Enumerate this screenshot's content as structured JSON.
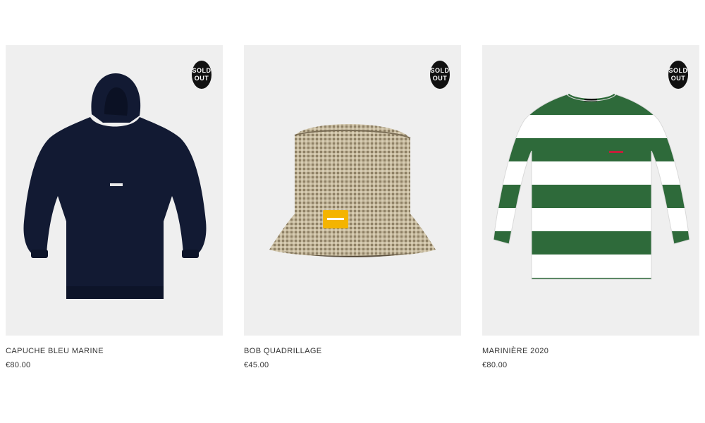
{
  "products": [
    {
      "title": "CAPUCHE BLEU MARINE",
      "price": "€80.00",
      "badge_line1": "SOLD",
      "badge_line2": "OUT",
      "image_icon": "hoodie-icon",
      "colors": {
        "garment": "#121a33"
      }
    },
    {
      "title": "BOB QUADRILLAGE",
      "price": "€45.00",
      "badge_line1": "SOLD",
      "badge_line2": "OUT",
      "image_icon": "bucket-hat-icon",
      "colors": {
        "garment": "#b9ad93",
        "tag": "#f4b400"
      }
    },
    {
      "title": "MARINIÈRE 2020",
      "price": "€80.00",
      "badge_line1": "SOLD",
      "badge_line2": "OUT",
      "image_icon": "striped-shirt-icon",
      "colors": {
        "stripe_green": "#2e6a3a",
        "stripe_white": "#ffffff"
      }
    }
  ]
}
